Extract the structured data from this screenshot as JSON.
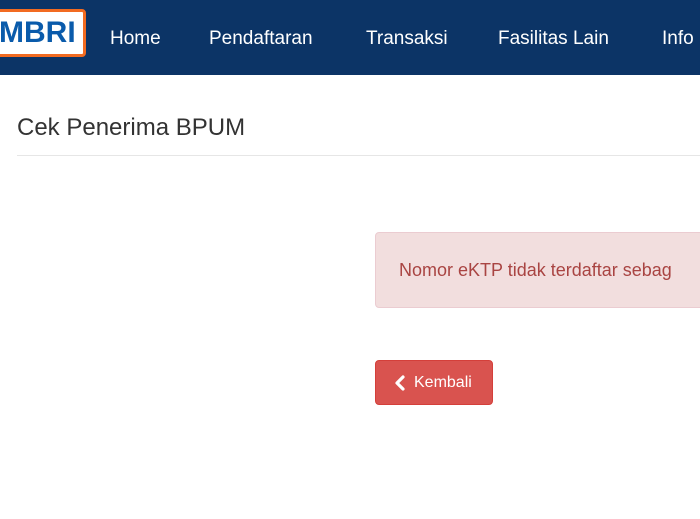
{
  "header": {
    "logo_text": "MBRI",
    "nav": [
      {
        "label": "Home"
      },
      {
        "label": "Pendaftaran"
      },
      {
        "label": "Transaksi"
      },
      {
        "label": "Fasilitas Lain"
      },
      {
        "label": "Info"
      }
    ]
  },
  "main": {
    "title": "Cek Penerima BPUM",
    "alert_text": "Nomor eKTP tidak terdaftar sebag",
    "back_button": {
      "icon": "chevron-left-icon",
      "label": "Kembali"
    }
  },
  "colors": {
    "navbar": "#0c3466",
    "logo_border": "#f26b21",
    "logo_text": "#0a5bab",
    "alert_bg": "#f2dede",
    "alert_text": "#a94442",
    "button_bg": "#d9534f"
  }
}
